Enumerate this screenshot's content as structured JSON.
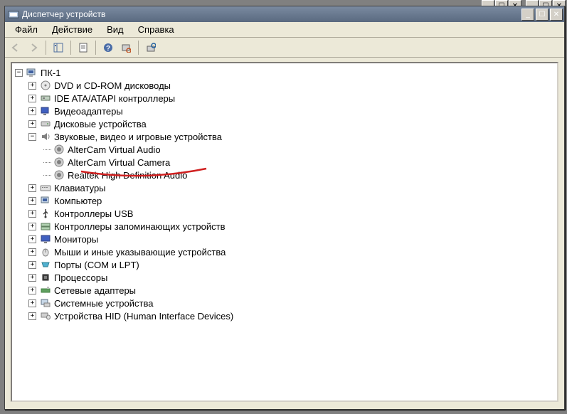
{
  "titlebar": {
    "title": "Диспетчер устройств"
  },
  "menu": {
    "file": "Файл",
    "action": "Действие",
    "view": "Вид",
    "help": "Справка"
  },
  "tree": {
    "root": "ПК-1",
    "dvd": "DVD и CD-ROM дисководы",
    "ide": "IDE ATA/ATAPI контроллеры",
    "video": "Видеоадаптеры",
    "disk": "Дисковые устройства",
    "sound": "Звуковые, видео и игровые устройства",
    "sound_children": {
      "a": "AlterCam Virtual Audio",
      "b": "AlterCam Virtual Camera",
      "c": "Realtek High Definition Audio"
    },
    "keyboard": "Клавиатуры",
    "computer": "Компьютер",
    "usb": "Контроллеры USB",
    "storage_ctrl": "Контроллеры запоминающих устройств",
    "monitors": "Мониторы",
    "mouse": "Мыши и иные указывающие устройства",
    "ports": "Порты (COM и LPT)",
    "cpu": "Процессоры",
    "network": "Сетевые адаптеры",
    "system": "Системные устройства",
    "hid": "Устройства HID (Human Interface Devices)"
  }
}
